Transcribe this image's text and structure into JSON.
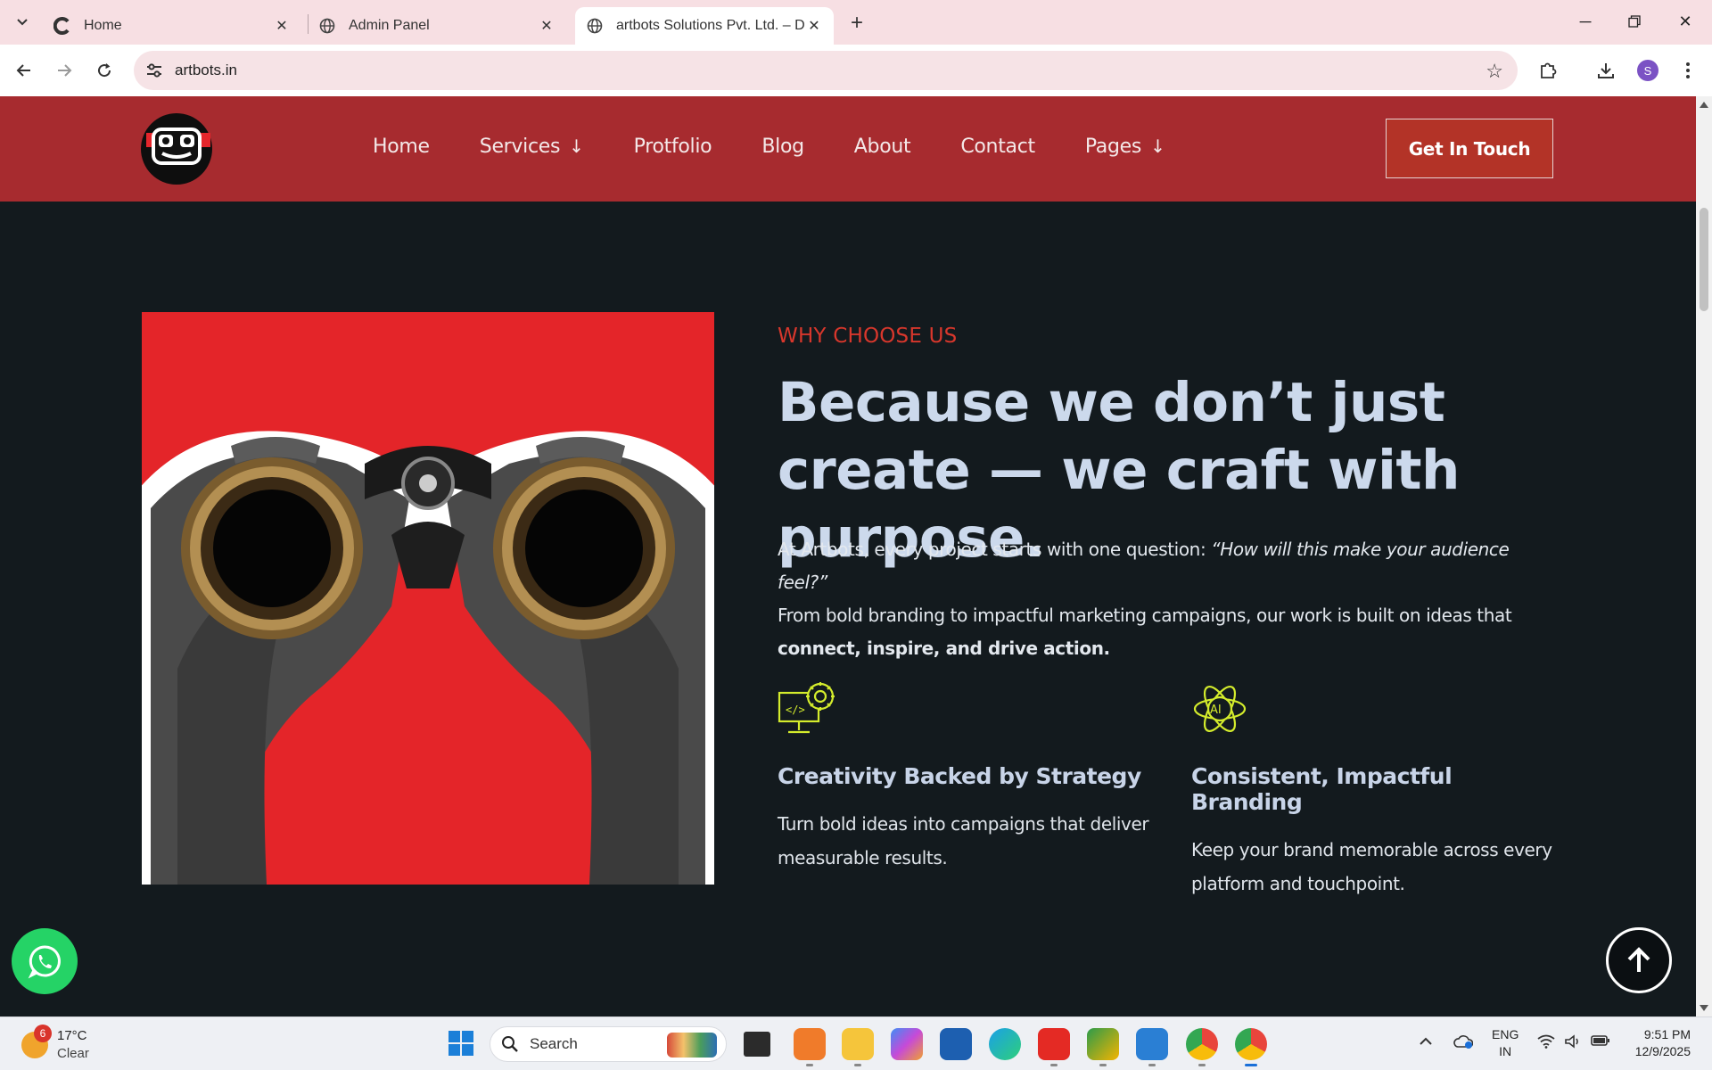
{
  "browser": {
    "tabs": [
      {
        "title": "Home",
        "active": false
      },
      {
        "title": "Admin Panel",
        "active": false
      },
      {
        "title": "artbots Solutions Pvt. Ltd. – Dig",
        "active": true
      }
    ],
    "url": "artbots.in",
    "profile_initial": "S"
  },
  "site": {
    "nav": [
      {
        "label": "Home",
        "has_dropdown": false
      },
      {
        "label": "Services",
        "has_dropdown": true
      },
      {
        "label": "Protfolio",
        "has_dropdown": false
      },
      {
        "label": "Blog",
        "has_dropdown": false
      },
      {
        "label": "About",
        "has_dropdown": false
      },
      {
        "label": "Contact",
        "has_dropdown": false
      },
      {
        "label": "Pages",
        "has_dropdown": true
      }
    ],
    "cta_label": "Get In Touch",
    "colors": {
      "header": "#a72b2f",
      "page_bg": "#131a1e",
      "accent": "#d8372c",
      "icon_accent": "#d4ec2c"
    }
  },
  "section": {
    "eyebrow": "WHY CHOOSE US",
    "headline": "Because we don’t just create — we craft with purpose.",
    "intro": {
      "p1_lead": "At Artbots, every project starts with one question: ",
      "p1_quote": "“How will this make your audience feel?”",
      "p2_lead": "From bold branding to impactful marketing campaigns, our work is built on ideas that ",
      "p2_bold": "connect, inspire, and drive action."
    },
    "features": [
      {
        "icon": "code-monitor-gear-icon",
        "title": "Creativity Backed by Strategy",
        "text": "Turn bold ideas into campaigns that deliver measurable results."
      },
      {
        "icon": "ai-atom-icon",
        "title": "Consistent, Impactful Branding",
        "text": "Keep your brand memorable across every platform and touchpoint."
      }
    ]
  },
  "taskbar": {
    "weather_badge": "6",
    "temperature": "17°C",
    "condition": "Clear",
    "search_label": "Search",
    "language_line1": "ENG",
    "language_line2": "IN",
    "time": "9:51 PM",
    "date": "12/9/2025"
  }
}
